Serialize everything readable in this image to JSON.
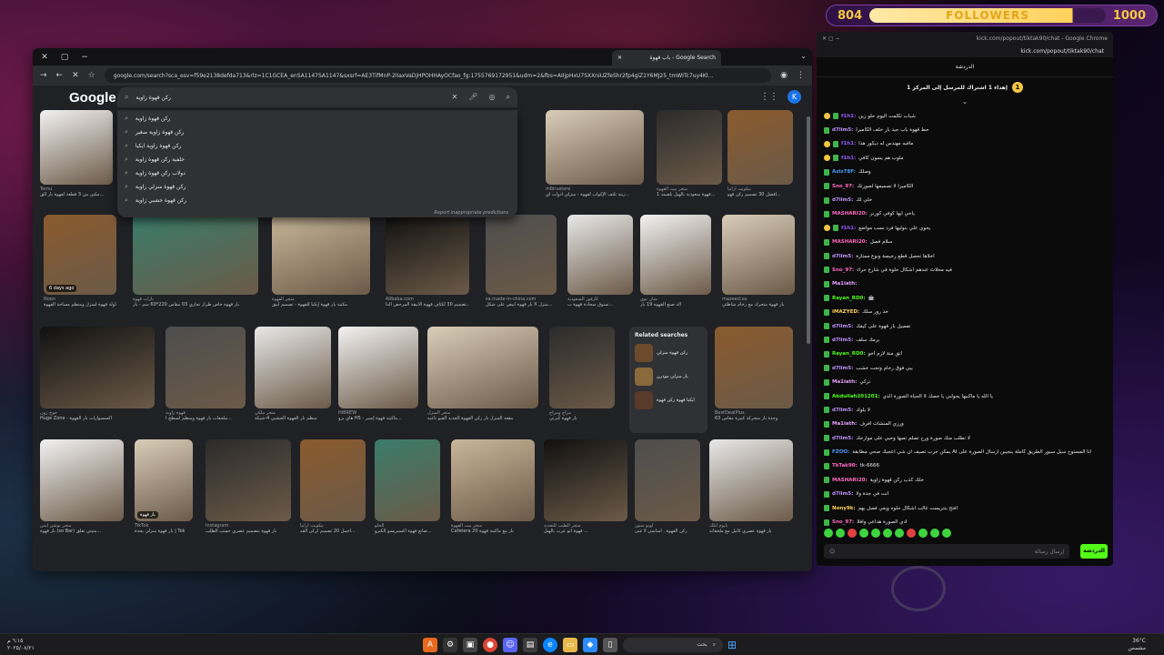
{
  "overlay": {
    "count_left": "804",
    "label": "FOLLOWERS",
    "goal": "1000",
    "progress_fraction": 0.804
  },
  "browser": {
    "tab_title": "باب قهوة - Google Search",
    "url": "google.com/search?sca_esv=f59e2138defda713&rlz=1C1GCEA_enSA1147SA1147&sxsrf=AE3TifMnP-2lIaxVaDjHPOHHAyOCfao_fg:1755769172951&udm=2&fbs=AIIjpHxU7SXXniUZfeShr2fp4giZ1Y6MJ25_tmWITc7uy4Kl...",
    "logo": "Google",
    "query": "ركن قهوة زاوية",
    "avatar_letter": "K",
    "suggestions": [
      "ركن قهوة زاوية",
      "ركن قهوة زاوية صغير",
      "ركن قهوة زاوية ايكيا",
      "خلفية ركن قهوة زاوية",
      "دولاب ركن قهوة زاوية",
      "ركن قهوة منزلي زاوية",
      "ركن قهوة خشبي زاوية"
    ],
    "report_text": "Report inappropriate predictions",
    "rows": [
      {
        "tiles": [
          {
            "src": "Temu",
            "cap": "مكين من 3 قطعة لقهوة بار الق...",
            "badge": ""
          },
          {
            "src": "mlbrustore",
            "cap": "زينة تلتف الإكواب لقهوة - منزلي أدوات اي...",
            "badge": ""
          },
          {
            "src": "متجر بيت القهوة",
            "cap": "قهوة سعودية بالهيل بلقيمة 1...",
            "badge": ""
          },
          {
            "src": "بيكويت أرابيا",
            "cap": "أفضل 30 تصميم ركن قهو...",
            "badge": ""
          }
        ]
      },
      {
        "tiles": [
          {
            "src": "Noon",
            "cap": "تسوق أثير طاولة قهوة لمنزل ومنظم مساحة القهوة",
            "badge": "6 days ago"
          },
          {
            "src": "بازات قهوة",
            "cap": "بار قهوة خاص طراز تجاري 03 مقاس 220*60 سم - بار",
            "badge": ""
          },
          {
            "src": "متجر القهوة",
            "cap": "مكتبة بار قهوة إيكيا للقهوة - تصميم أنيق",
            "badge": ""
          },
          {
            "src": "Alibaba.com",
            "cap": "تصميم 30 لكثاف قهوة الأنيقة المرحض الدا...",
            "badge": ""
          },
          {
            "src": "sa.made-in-china.com",
            "cap": "بار قهوة أبيض على شكل X منزل...",
            "badge": ""
          },
          {
            "src": "كارفور السعودية",
            "cap": "تسوق سجادة قهوة ب...",
            "badge": ""
          },
          {
            "src": "شان نوي",
            "cap": "آلة صنع القهوة 19 بار",
            "badge": ""
          },
          {
            "src": "mazeed.sa",
            "cap": "بار قهوة متحرك مع رخام شاطئي",
            "badge": ""
          }
        ]
      },
      {
        "tiles": [
          {
            "src": "جوج زون",
            "cap": "Huge Zone - اكسسوارات بار القهوة",
            "badge": ""
          },
          {
            "src": "قهوة زاوية",
            "cap": "ملحقات بار قهوة ومنظم لسطح ا...",
            "badge": ""
          },
          {
            "src": "متجر ملكي",
            "cap": "منظم بار القهوة الخشبي 4-شبكة",
            "badge": ""
          },
          {
            "src": "HiBREW",
            "cap": "هاي برو H5 - ماكينة قهوة إسبر...",
            "badge": ""
          },
          {
            "src": "متجر المنزل",
            "cap": "مقعد المنزل بار ركن القهوة الجديد الفبو تاعية",
            "badge": ""
          },
          {
            "src": "مزاج ومزاج",
            "cap": "بار قهوة كبرتي",
            "badge": ""
          },
          {
            "src": "BestDealPlus",
            "cap": "وحدة بار متحركة كبيرة مقاس 63",
            "badge": ""
          }
        ]
      },
      {
        "tiles": [
          {
            "src": "متجر بوشن ايس",
            "cap": "بار قهوة (so Bar) مثيتي تعلق...",
            "badge": ""
          },
          {
            "src": "TikTok",
            "cap": "بار قهوة منزلي بجدة | Tok",
            "badge": "بار قهوة"
          },
          {
            "src": "Instagram",
            "cap": "بار قهوة بتصميم عصري حسب الطلب",
            "badge": ""
          },
          {
            "src": "بيكويت أرابيا",
            "cap": "أجمل 20 تصميم لركن القه...",
            "badge": ""
          },
          {
            "src": "الحلو",
            "cap": "صانع قهوة اكسبريسو الكترو...",
            "badge": ""
          },
          {
            "src": "متجر بيت القهوة",
            "cap": "Cafetera 20 بار مع ماكينة قهوة",
            "badge": ""
          },
          {
            "src": "متجر الطيب للتغذية",
            "cap": "قهوة أبو عرب بالهيل ...",
            "badge": ""
          },
          {
            "src": "لوبو ستور",
            "cap": "ركن القهوة . أساسي لا غنى",
            "badge": ""
          },
          {
            "src": "بايوم لتلك",
            "cap": "بار قهوة عصري كامل مع ملحقاته",
            "badge": ""
          }
        ]
      }
    ],
    "related": {
      "title": "Related searches",
      "items": [
        "ركن قهوة منزلي",
        "بار منزلي مودرن",
        "ايكيا قهوة ركن قهوة"
      ]
    }
  },
  "chat": {
    "window_title": "kick.com/popout/tiktak90/chat - Google Chrome",
    "url": "kick.com/popout/tiktak90/chat",
    "title": "الدردشة",
    "pinned": "إهداء 1 اشتراك للمرسل إلى المركز 1",
    "pinned_count": "1",
    "messages": [
      {
        "user": "f1h1:",
        "color": "#9b59ff",
        "text": "شباب تكلمت اليوم حلو زين",
        "badge": true
      },
      {
        "user": "d7lim5:",
        "color": "#bf94ff",
        "text": "حط قهوة باب جيد بار خلف الكاميرا",
        "badge": false
      },
      {
        "user": "f1h1:",
        "color": "#9b59ff",
        "text": "مافيه مهندس له ديكور هذا",
        "badge": true
      },
      {
        "user": "f1h1:",
        "color": "#9b59ff",
        "text": "ملوب هم يسون كافي",
        "badge": true
      },
      {
        "user": "Aziz78F:",
        "color": "#4f9eff",
        "text": "وصلك",
        "badge": false
      },
      {
        "user": "Sno_97:",
        "color": "#ff6ac1",
        "text": "الكاميرا لا تصميمها لصورتك",
        "badge": false
      },
      {
        "user": "d7lim5:",
        "color": "#bf94ff",
        "text": "خلي لك",
        "badge": false
      },
      {
        "user": "MASHARI20:",
        "color": "#ff6ac1",
        "text": "ياخي ايها كوفي كورنر",
        "badge": false
      },
      {
        "user": "f1h1:",
        "color": "#9b59ff",
        "text": "يحوي علي بنوليها فرد نسب مواضع",
        "badge": true
      },
      {
        "user": "MASHARI20:",
        "color": "#ff6ac1",
        "text": "سلام فصل",
        "badge": false
      },
      {
        "user": "d7lim5:",
        "color": "#bf94ff",
        "text": "اخلاها تحصل قطع رخيصة ونوع ممتازة",
        "badge": false
      },
      {
        "user": "Sno_97:",
        "color": "#ff6ac1",
        "text": "فيه محلات عندهم اشكال حلوة في شارع حراء",
        "badge": false
      },
      {
        "user": "Ma1iath:",
        "color": "#e8a0ff",
        "text": "",
        "badge": false
      },
      {
        "user": "Rayan_RD0:",
        "color": "#53fc18",
        "text": "🤖",
        "badge": false
      },
      {
        "user": "iMAZYED:",
        "color": "#ffd15c",
        "text": "خذ رور سلك",
        "badge": false
      },
      {
        "user": "d7lim5:",
        "color": "#bf94ff",
        "text": "تفصيل بار قهوة على كيفك",
        "badge": false
      },
      {
        "user": "d7lim5:",
        "color": "#bf94ff",
        "text": "برمك سلف",
        "badge": false
      },
      {
        "user": "Rayan_RD0:",
        "color": "#53fc18",
        "text": "اتق منة لازم اخو",
        "badge": false
      },
      {
        "user": "d7lim5:",
        "color": "#bf94ff",
        "text": "يبي فوق رخام وتحت خشب",
        "badge": false
      },
      {
        "user": "Ma1iath:",
        "color": "#e8a0ff",
        "text": "تركي",
        "badge": false
      },
      {
        "user": "Abdullah201201:",
        "color": "#53fc18",
        "text": "يا الله يا ماكنيها يحولني يا خصك لا الحياة الصورة الذي",
        "badge": false
      },
      {
        "user": "d7lim5:",
        "color": "#bf94ff",
        "text": "لا يلوك",
        "badge": false
      },
      {
        "user": "Ma1iath:",
        "color": "#e8a0ff",
        "text": "ورزي المنشات افرف",
        "badge": false
      },
      {
        "user": "d7lim5:",
        "color": "#bf94ff",
        "text": "لا تطلب منك صورة ورح تصلم تصها وحيي على موارحك",
        "badge": false
      },
      {
        "user": "FZOO:",
        "color": "#4f9eff",
        "text": "يمكن جرب تصيف ان شي اعجبك صحي مطابقة AI انا المستوخ سيل سيور الطريق كاملة ينجيبن ارسال الصورة على",
        "badge": false
      },
      {
        "user": "TkTak90:",
        "color": "#ff6ac1",
        "text": "tk-6666",
        "badge": false
      },
      {
        "user": "MASHARI20:",
        "color": "#ff6ac1",
        "text": "خلك كذب ركن قهوة زاوية",
        "badge": false
      },
      {
        "user": "d7lim5:",
        "color": "#bf94ff",
        "text": "انت في جدة ولا",
        "badge": false
      },
      {
        "user": "Nony9k:",
        "color": "#ffd15c",
        "text": "افتح بنتريست غالب اشكال حلوه ويعي فصل بهم",
        "badge": false
      },
      {
        "user": "Sno_97:",
        "color": "#ff6ac1",
        "text": "ادي الصورة هداعي وافلا",
        "badge": false
      }
    ],
    "input_placeholder": "إرسال رسالة",
    "send_label": "الدردشة"
  },
  "taskbar": {
    "time": "٦:١٥ م",
    "date": "٢٠٢٥/٠٨/٢١",
    "search_placeholder": "بحث",
    "weather": "36°C",
    "weather_label": "مشمس"
  }
}
